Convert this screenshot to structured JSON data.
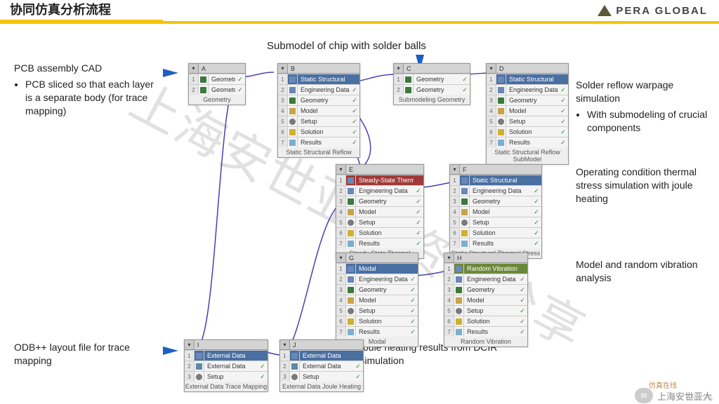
{
  "header": {
    "title": "协同仿真分析流程",
    "brand": "PERA GLOBAL"
  },
  "watermark": "上海安世亚太资料分享",
  "footer": {
    "wechat_label": "上海安世亚大",
    "brand": "ANSYS",
    "cn": "仿真在线"
  },
  "annotations": {
    "submodel": "Submodel of chip with solder balls",
    "pcb_title": "PCB assembly CAD",
    "pcb_bullet": "PCB sliced so that each layer is a separate body (for trace mapping)",
    "reflow_title": "Solder reflow warpage simulation",
    "reflow_bullet": "With submodeling of crucial components",
    "thermal": "Operating condition thermal stress simulation with joule heating",
    "vibration": "Model and random vibration analysis",
    "odb": "ODB++ layout file for trace mapping",
    "joule": "Joule heating results from DCIR Simulation"
  },
  "common_rows": {
    "eng": "Engineering Data",
    "geo": "Geometry",
    "mod": "Model",
    "set": "Setup",
    "sol": "Solution",
    "res": "Results",
    "ext": "External Data"
  },
  "blocks": {
    "A": {
      "letter": "A",
      "title": "",
      "rows": [
        "geo",
        "geo"
      ],
      "rowlabels": [
        "Geometry",
        "Geometry"
      ],
      "caption": "Geometry",
      "header_color": "grey"
    },
    "B": {
      "letter": "B",
      "title": "Static Structural",
      "rows": [
        "eng",
        "geo",
        "mod",
        "set",
        "sol",
        "res"
      ],
      "caption": "Static Structural Reflow"
    },
    "C": {
      "letter": "C",
      "title": "",
      "rows": [
        "geo",
        "geo"
      ],
      "rowlabels": [
        "Geometry",
        "Geometry"
      ],
      "caption": "Submodeling Geometry"
    },
    "D": {
      "letter": "D",
      "title": "Static Structural",
      "rows": [
        "eng",
        "geo",
        "mod",
        "set",
        "sol",
        "res"
      ],
      "caption": "Static Structural Reflow SubModel"
    },
    "E": {
      "letter": "E",
      "title": "Steady-State Thermal",
      "rows": [
        "eng",
        "geo",
        "mod",
        "set",
        "sol",
        "res"
      ],
      "caption": "Steady-State Thermal",
      "header_color": "red"
    },
    "F": {
      "letter": "F",
      "title": "Static Structural",
      "rows": [
        "eng",
        "geo",
        "mod",
        "set",
        "sol",
        "res"
      ],
      "caption": "Static Structural Thermal Stress"
    },
    "G": {
      "letter": "G",
      "title": "Modal",
      "rows": [
        "eng",
        "geo",
        "mod",
        "set",
        "sol",
        "res"
      ],
      "caption": "Modal"
    },
    "H": {
      "letter": "H",
      "title": "Random Vibration",
      "rows": [
        "eng",
        "geo",
        "mod",
        "set",
        "sol",
        "res"
      ],
      "caption": "Random Vibration",
      "header_color": "green"
    },
    "I": {
      "letter": "I",
      "title": "External Data",
      "rows": [
        "ext",
        "set"
      ],
      "rowlabels": [
        "External Data",
        "Setup"
      ],
      "caption": "External Data Trace Mapping"
    },
    "J": {
      "letter": "J",
      "title": "External Data",
      "rows": [
        "ext",
        "set"
      ],
      "rowlabels": [
        "External Data",
        "Setup"
      ],
      "caption": "External Data Joule Heating"
    }
  }
}
